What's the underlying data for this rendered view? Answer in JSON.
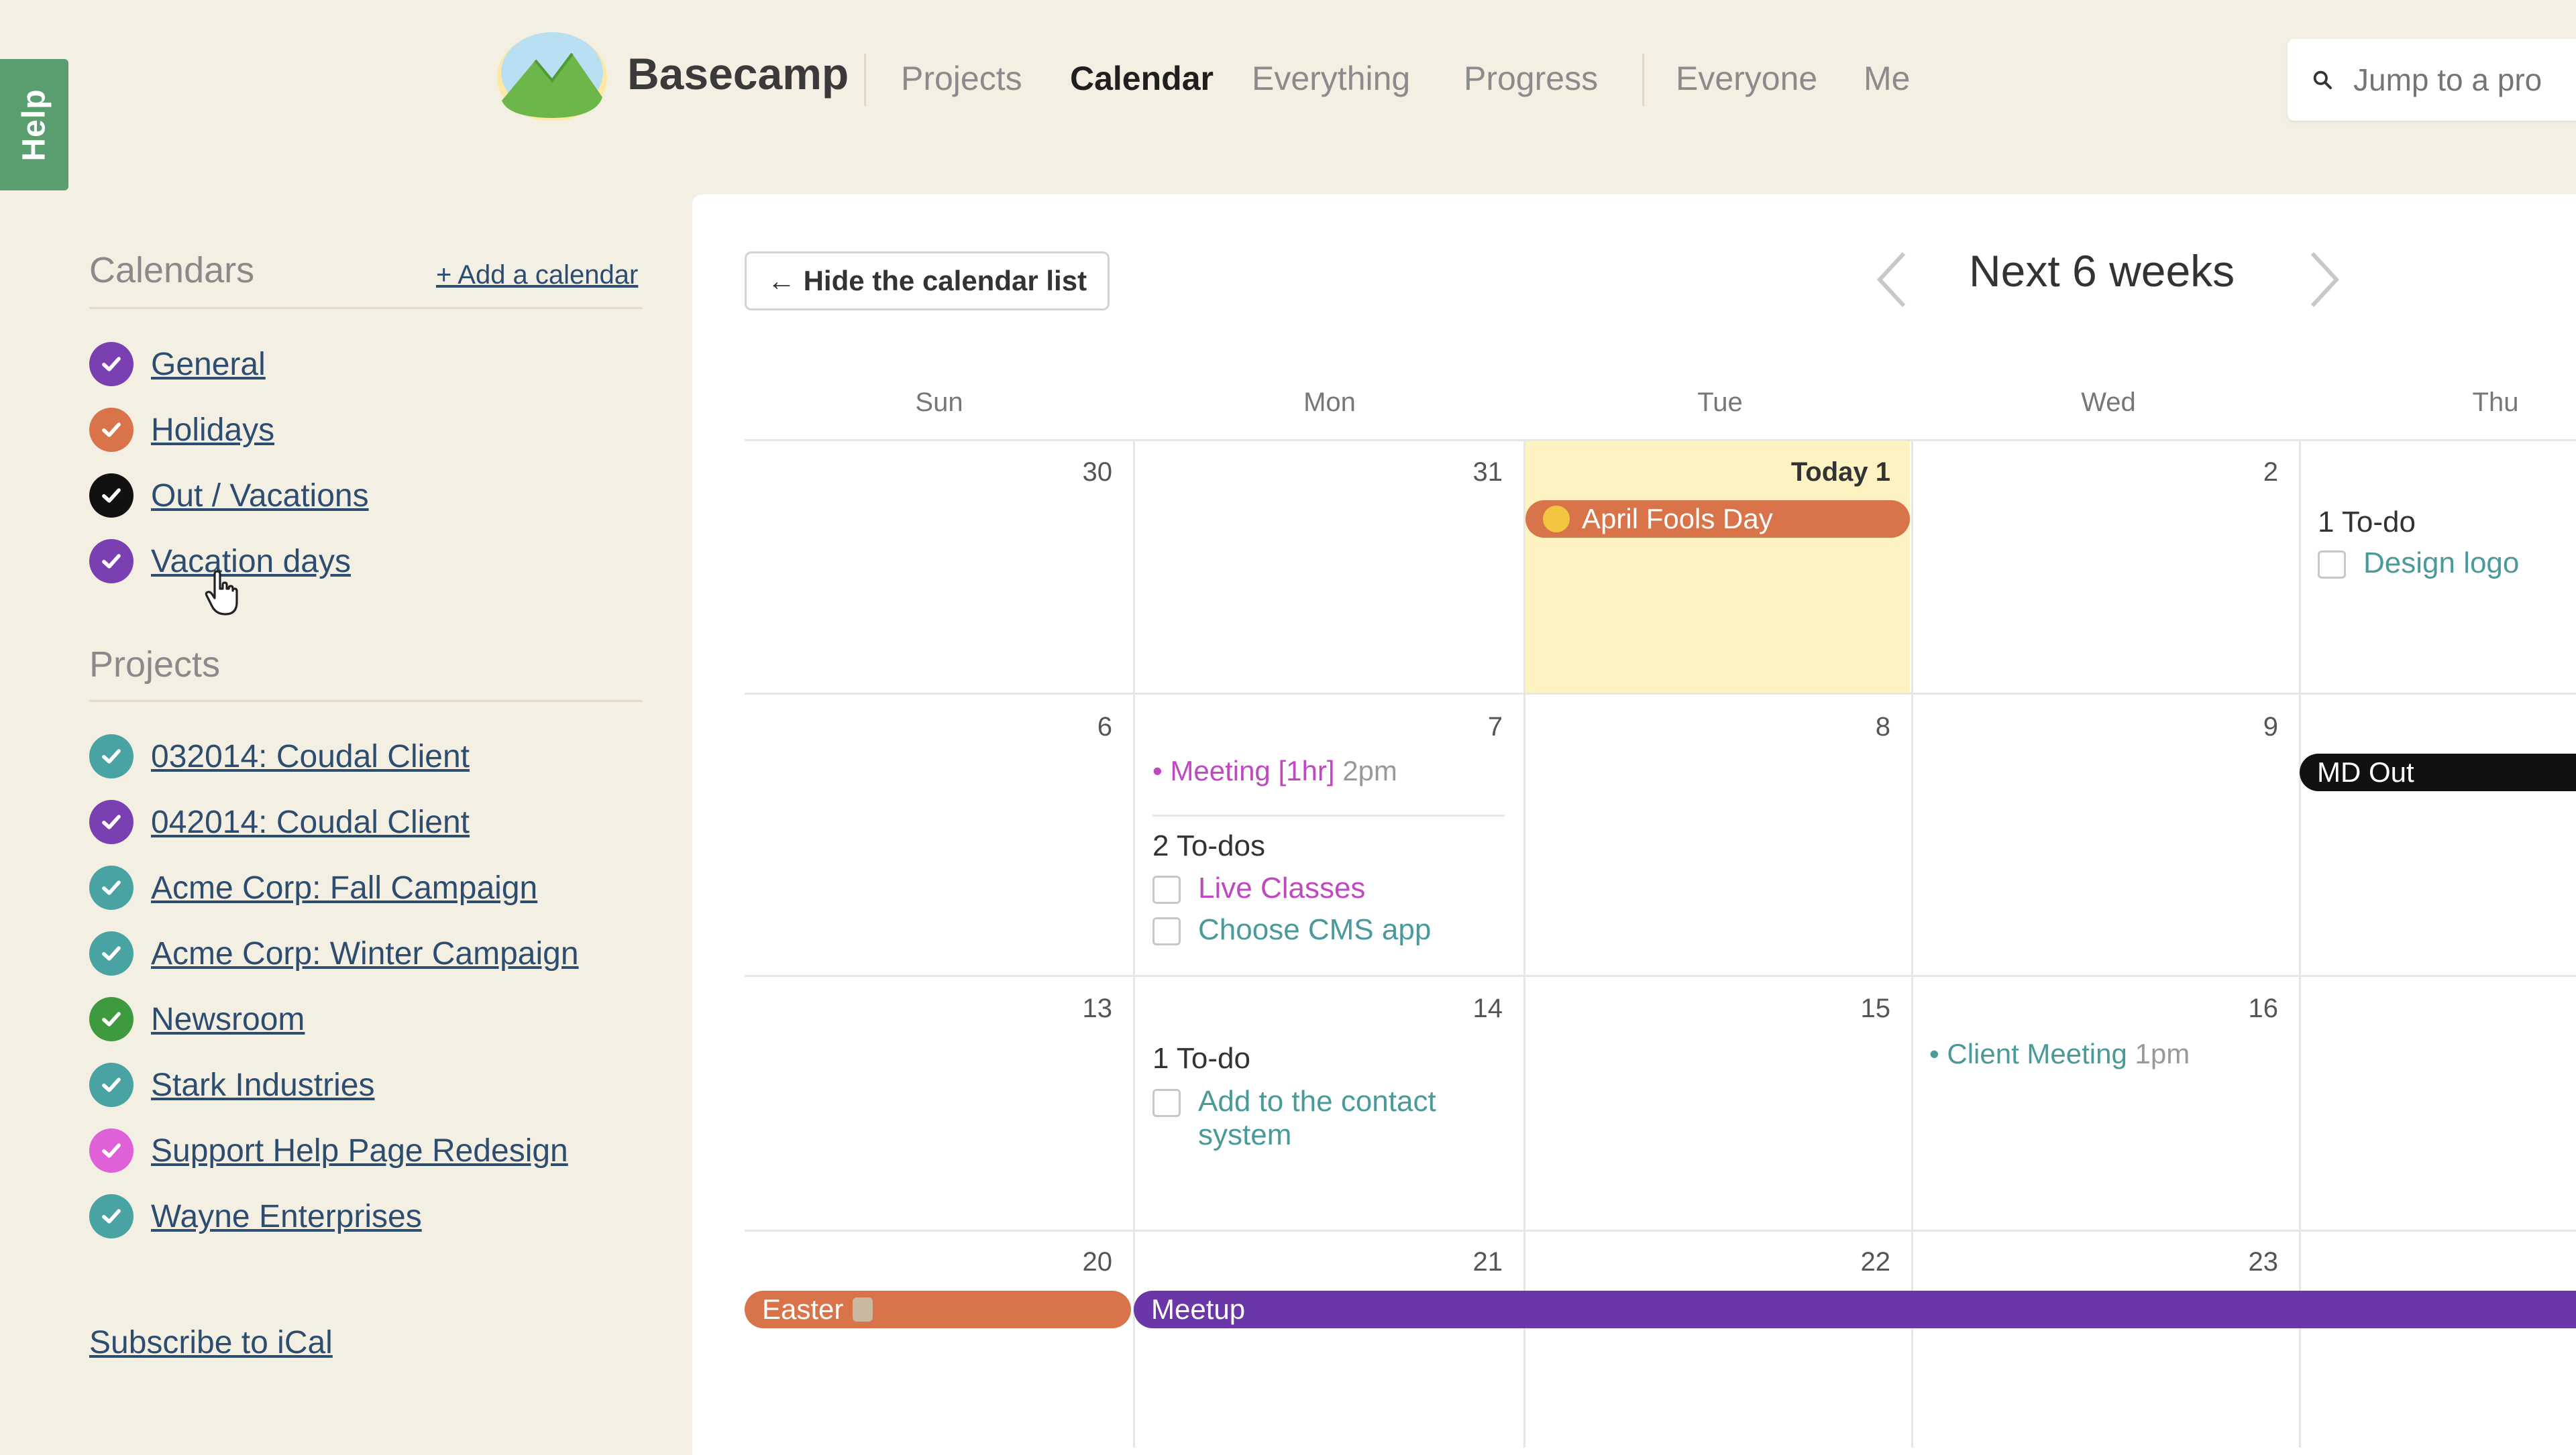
{
  "help_tab": {
    "label": "Help"
  },
  "header": {
    "brand": "Basecamp",
    "nav": [
      {
        "label": "Projects",
        "active": false
      },
      {
        "label": "Calendar",
        "active": true
      },
      {
        "label": "Everything",
        "active": false
      },
      {
        "label": "Progress",
        "active": false
      },
      {
        "label": "Everyone",
        "active": false
      },
      {
        "label": "Me",
        "active": false
      }
    ],
    "search": {
      "placeholder": "Jump to a pro",
      "icon": "search-icon"
    }
  },
  "sidebar": {
    "calendars_heading": "Calendars",
    "add_calendar": "+ Add a calendar",
    "calendars": [
      {
        "label": "General",
        "color": "#7a3fb0"
      },
      {
        "label": "Holidays",
        "color": "#d9744a"
      },
      {
        "label": "Out / Vacations",
        "color": "#111111"
      },
      {
        "label": "Vacation days",
        "color": "#7a3fb0"
      }
    ],
    "projects_heading": "Projects",
    "projects": [
      {
        "label": "032014: Coudal Client",
        "color": "#4aa3a3"
      },
      {
        "label": "042014: Coudal Client",
        "color": "#7a3fb0"
      },
      {
        "label": "Acme Corp: Fall Campaign",
        "color": "#4aa3a3"
      },
      {
        "label": "Acme Corp: Winter Campaign",
        "color": "#4aa3a3"
      },
      {
        "label": "Newsroom",
        "color": "#3e9a3e"
      },
      {
        "label": "Stark Industries",
        "color": "#4aa3a3"
      },
      {
        "label": "Support Help Page Redesign",
        "color": "#e060d8"
      },
      {
        "label": "Wayne Enterprises",
        "color": "#4aa3a3"
      }
    ],
    "subscribe": "Subscribe to iCal"
  },
  "calendar": {
    "hide_button": "← Hide the calendar list",
    "range_title": "Next 6 weeks",
    "weekdays": [
      "Sun",
      "Mon",
      "Tue",
      "Wed",
      "Thu"
    ],
    "weeks": [
      [
        "30",
        "31",
        "Today 1",
        "2",
        ""
      ],
      [
        "6",
        "7",
        "8",
        "9",
        ""
      ],
      [
        "13",
        "14",
        "15",
        "16",
        ""
      ],
      [
        "20",
        "21",
        "22",
        "23",
        ""
      ]
    ],
    "events": {
      "april_fools": "April Fools Day",
      "md_out": "MD Out",
      "easter": "Easter",
      "meetup": "Meetup",
      "meeting_title": "Meeting [1hr]",
      "meeting_time": "2pm",
      "client_meeting_title": "Client Meeting",
      "client_meeting_time": "1pm"
    },
    "todos": {
      "thu_head": "1 To-do",
      "thu_items": [
        "Design logo"
      ],
      "mon7_head": "2 To-dos",
      "mon7_items": [
        "Live Classes",
        "Choose CMS app"
      ],
      "mon14_head": "1 To-do",
      "mon14_items": [
        "Add to the contact system"
      ]
    }
  }
}
